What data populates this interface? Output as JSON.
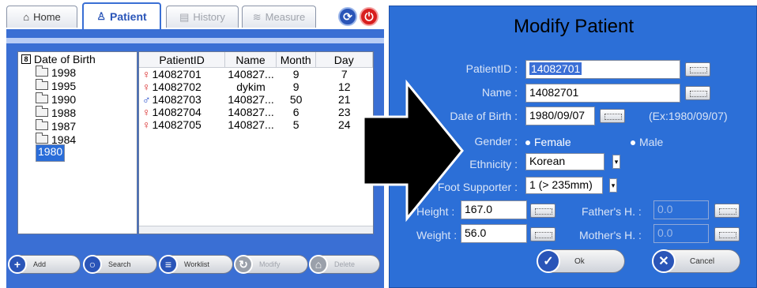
{
  "left": {
    "tabs": {
      "home": "Home",
      "patient": "Patient",
      "history": "History",
      "measure": "Measure"
    },
    "tree": {
      "root": "Date of Birth",
      "items": [
        "1998",
        "1995",
        "1990",
        "1988",
        "1987",
        "1984",
        "1980"
      ]
    },
    "table": {
      "headers": [
        "PatientID",
        "Name",
        "Month",
        "Day"
      ],
      "rows": [
        {
          "gender": "female",
          "id": "14082701",
          "name": "140827...",
          "month": "9",
          "day": "7"
        },
        {
          "gender": "female",
          "id": "14082702",
          "name": "dykim",
          "month": "9",
          "day": "12"
        },
        {
          "gender": "male",
          "id": "14082703",
          "name": "140827...",
          "month": "50",
          "day": "21"
        },
        {
          "gender": "female",
          "id": "14082704",
          "name": "140827...",
          "month": "6",
          "day": "23"
        },
        {
          "gender": "female",
          "id": "14082705",
          "name": "140827...",
          "month": "5",
          "day": "24"
        }
      ]
    },
    "buttons": {
      "add": "Add",
      "search": "Search",
      "worklist": "Worklist",
      "modify": "Modify",
      "delete": "Delete"
    }
  },
  "dialog": {
    "title": "Modify Patient",
    "labels": {
      "patient_id": "PatientID :",
      "name": "Name :",
      "dob": "Date of Birth :",
      "gender": "Gender :",
      "ethnicity": "Ethnicity :",
      "foot_supporter": "Foot Supporter :",
      "height": "Height :",
      "weight": "Weight :",
      "father_h": "Father's H. :",
      "mother_h": "Mother's H. :"
    },
    "values": {
      "patient_id": "14082701",
      "name": "14082701",
      "dob": "1980/09/07",
      "dob_hint": "(Ex:1980/09/07)",
      "gender_female": "Female",
      "gender_male": "Male",
      "ethnicity": "Korean",
      "foot_supporter": "1 (> 235mm)",
      "height": "167.0",
      "weight": "56.0",
      "father_h": "0.0",
      "mother_h": "0.0"
    },
    "buttons": {
      "ok": "Ok",
      "cancel": "Cancel"
    }
  },
  "colors": {
    "panel_blue": "#3a6fd4",
    "dialog_blue": "#2c6fd7",
    "female_red": "#d61c1c",
    "male_blue": "#1f46c9",
    "selection": "#2a6dd9"
  }
}
